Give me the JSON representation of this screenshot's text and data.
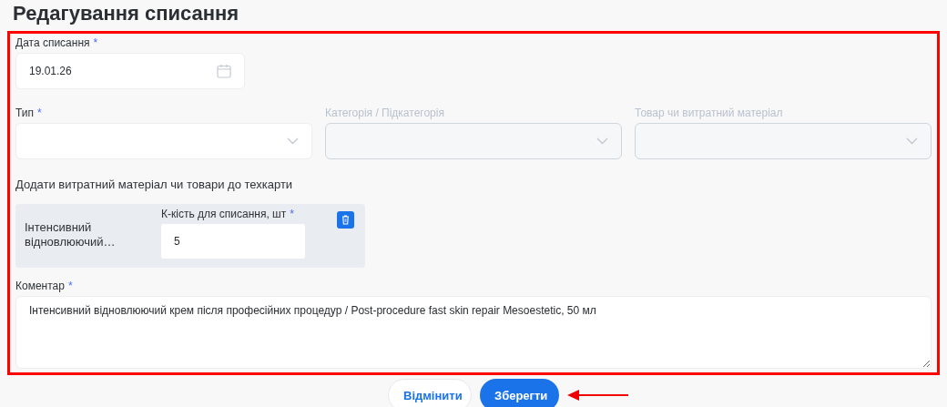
{
  "title": "Редагування списання",
  "highlight": {
    "frame": true,
    "arrow": true
  },
  "date_field": {
    "label": "Дата списання",
    "required_mark": "*",
    "value": "19.01.26"
  },
  "selects": [
    {
      "label": "Тип",
      "required_mark": "*",
      "disabled": false
    },
    {
      "label": "Категорія / Підкатегорія",
      "disabled": true
    },
    {
      "label": "Товар чи витратний матеріал",
      "disabled": true
    }
  ],
  "section_heading": "Додати витратний матеріал чи товари до техкарти",
  "items": [
    {
      "name": "Інтенсивний відновлюючий…",
      "quantity_label": "К-кість для списання, шт",
      "required_mark": "*",
      "quantity": "5"
    }
  ],
  "comment": {
    "label": "Коментар",
    "required_mark": "*",
    "value": "Інтенсивний відновлюючий крем після професійних процедур / Post-procedure fast skin repair Mesoestetic, 50 мл"
  },
  "buttons": [
    {
      "label": "Відмінити",
      "kind": "secondary"
    },
    {
      "label": "Зберегти",
      "kind": "primary"
    }
  ]
}
